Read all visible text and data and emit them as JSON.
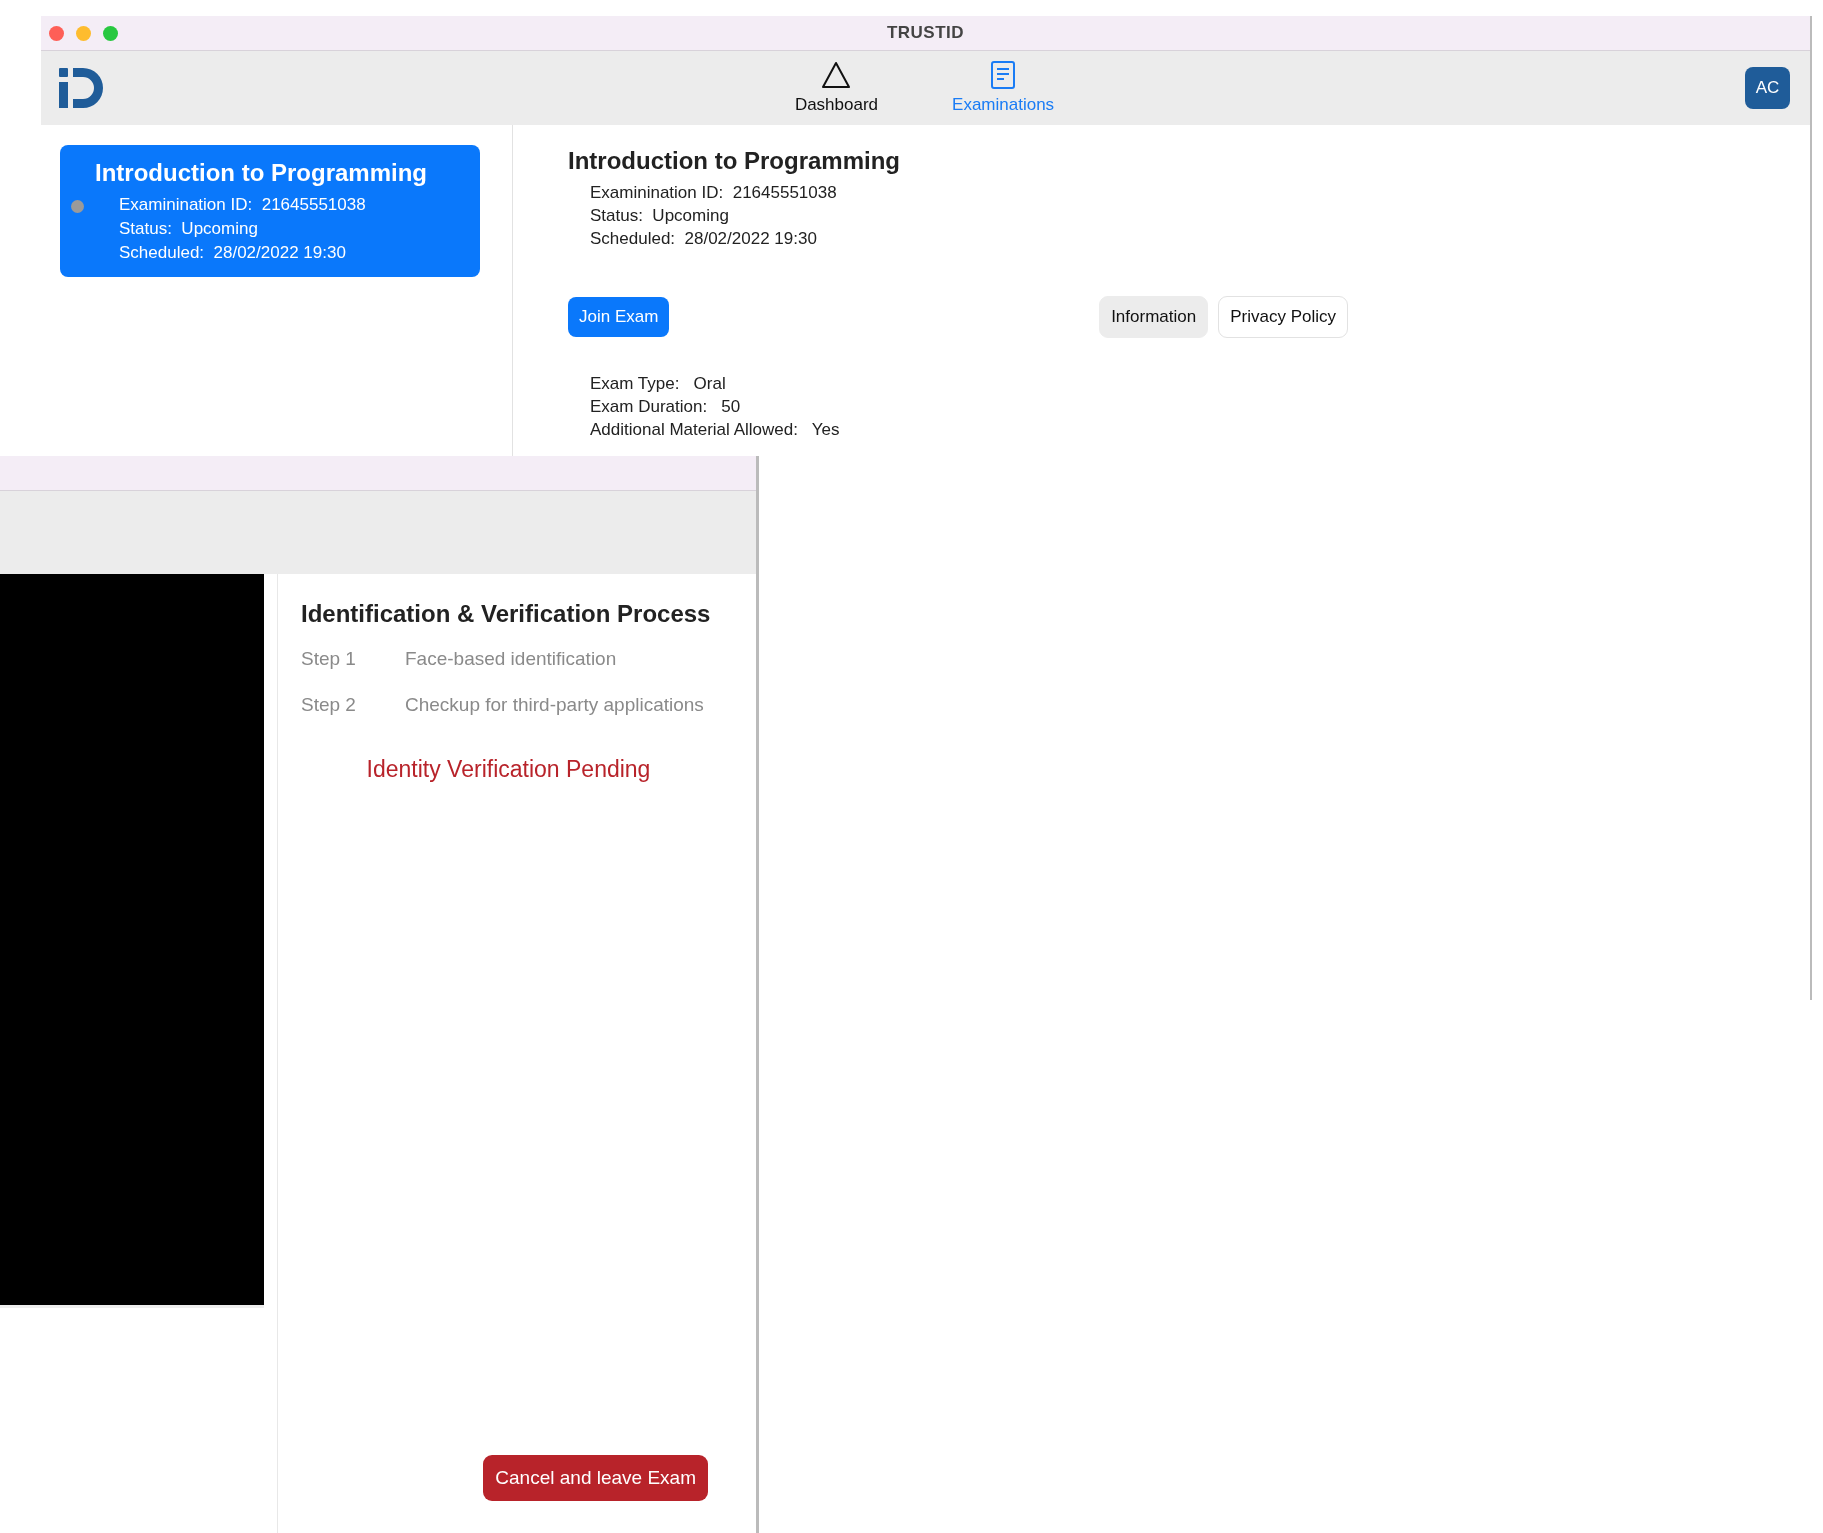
{
  "window": {
    "title": "TRUSTID"
  },
  "nav": [
    {
      "kind": "dashboard",
      "label": "Dashboard",
      "selected": false
    },
    {
      "kind": "examinations",
      "label": "Examinations",
      "selected": true
    }
  ],
  "avatar": {
    "initials": "AC"
  },
  "exam_list": [
    {
      "title": "Introduction to Programming",
      "selected": true,
      "lines": [
        "Examinination ID:  21645551038",
        "Status:  Upcoming",
        "Scheduled:  28/02/2022 19:30"
      ]
    }
  ],
  "detail": {
    "title": "Introduction to Programming",
    "lines": [
      "Examinination ID:  21645551038",
      "Status:  Upcoming",
      "Scheduled:  28/02/2022 19:30"
    ],
    "join_button": "Join Exam",
    "tabs": [
      {
        "label": "Information",
        "selected": true
      },
      {
        "label": "Privacy Policy",
        "selected": false
      }
    ],
    "info": [
      "Exam Type:   Oral",
      "Exam Duration:   50",
      "Additional Material Allowed:   Yes"
    ]
  },
  "verification": {
    "title": "Identification & Verification Process",
    "steps": [
      {
        "step": "Step 1",
        "label": "Face-based identification"
      },
      {
        "step": "Step 2",
        "label": "Checkup for third-party applications"
      }
    ],
    "status": "Identity Verification Pending",
    "cancel_button": "Cancel and leave Exam"
  }
}
